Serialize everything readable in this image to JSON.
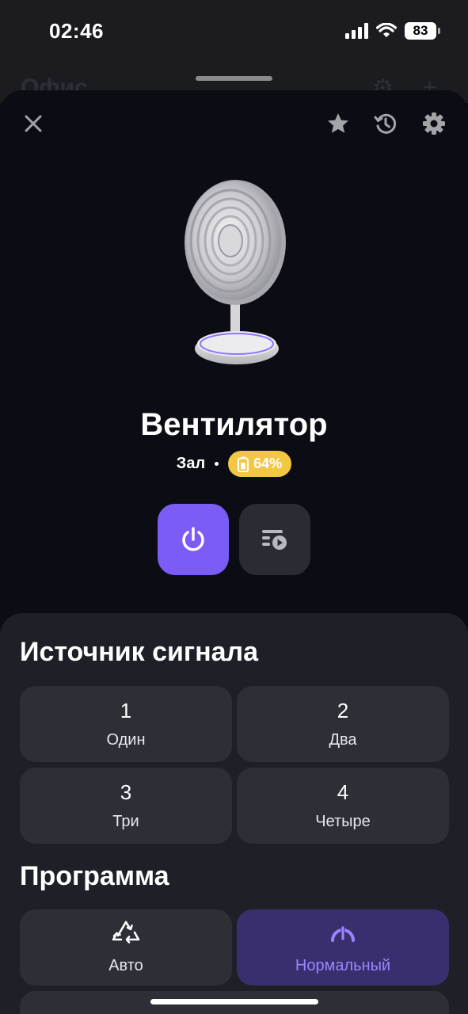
{
  "status_bar": {
    "time": "02:46",
    "battery": "83"
  },
  "background_page": {
    "title": "Офис"
  },
  "device": {
    "name": "Вентилятор",
    "room": "Зал",
    "battery_percent": "64%"
  },
  "colors": {
    "accent": "#7b5cf5",
    "battery_badge": "#f2c744",
    "active_tile": "#3a2f6e",
    "active_label": "#9b84ff"
  },
  "signal_source": {
    "title": "Источник сигнала",
    "options": [
      {
        "number": "1",
        "label": "Один"
      },
      {
        "number": "2",
        "label": "Два"
      },
      {
        "number": "3",
        "label": "Три"
      },
      {
        "number": "4",
        "label": "Четыре"
      }
    ]
  },
  "program": {
    "title": "Программа",
    "options": [
      {
        "icon": "recycle-icon",
        "label": "Авто",
        "selected": false
      },
      {
        "icon": "speedometer-icon",
        "label": "Нормальный",
        "selected": true
      }
    ]
  }
}
